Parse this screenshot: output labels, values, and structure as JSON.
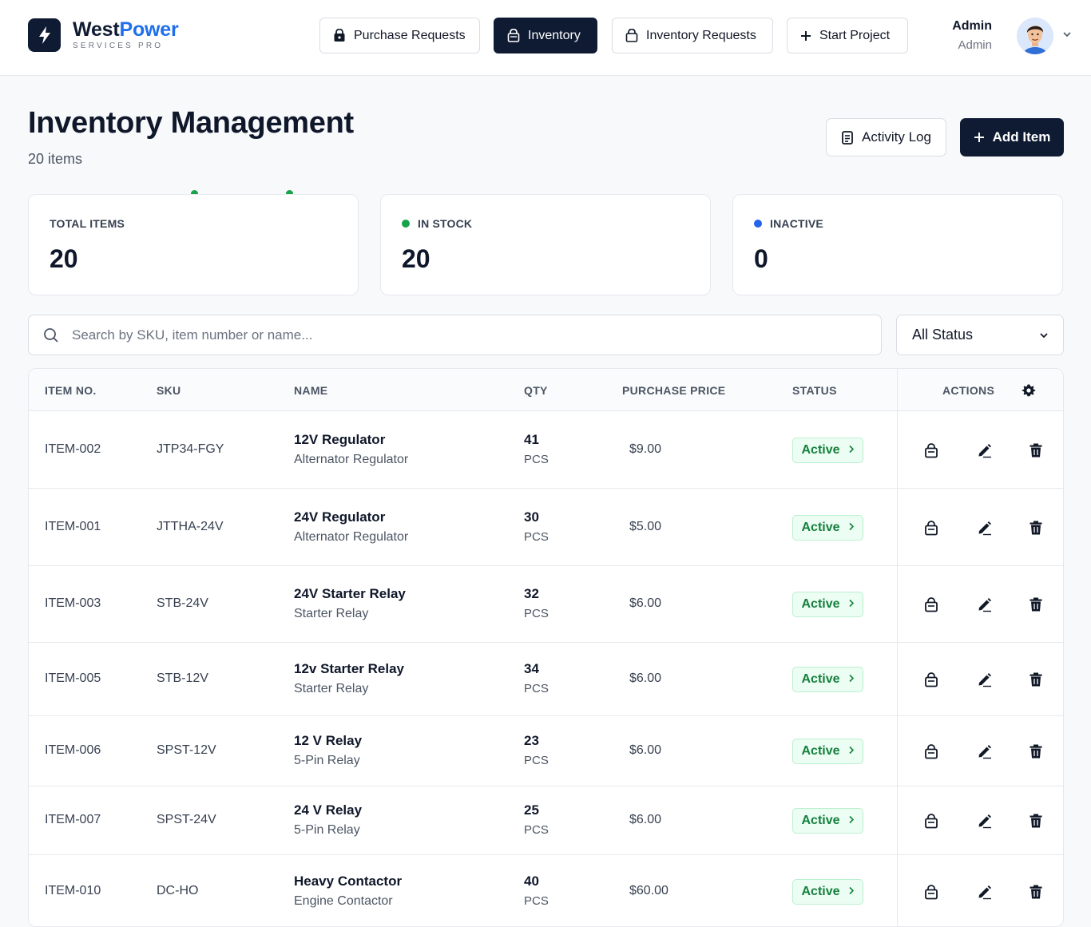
{
  "brand": {
    "name_part1": "West",
    "name_part2": "Power",
    "tagline": "SERVICES PRO"
  },
  "nav": [
    {
      "label": "Purchase Requests",
      "icon": "bag-icon"
    },
    {
      "label": "Inventory",
      "icon": "bag-icon",
      "active": true
    },
    {
      "label": "Inventory Requests",
      "icon": "bag-icon"
    },
    {
      "label": "Start Project",
      "icon": "plus-icon"
    }
  ],
  "user": {
    "name": "Admin",
    "role": "Admin"
  },
  "page": {
    "title": "Inventory Management",
    "subtitle": "20 items"
  },
  "actions": {
    "activity_log": "Activity Log",
    "add_item": "Add Item"
  },
  "stats": [
    {
      "label": "TOTAL ITEMS",
      "value": "20",
      "dot_color": ""
    },
    {
      "label": "IN STOCK",
      "value": "20",
      "dot_color": "#16a34a"
    },
    {
      "label": "INACTIVE",
      "value": "0",
      "dot_color": "#2563eb"
    }
  ],
  "search": {
    "placeholder": "Search by SKU, item number or name...",
    "value": ""
  },
  "status_filter": {
    "selected": "All Status"
  },
  "table": {
    "columns": [
      "ITEM NO.",
      "SKU",
      "NAME",
      "QTY",
      "PURCHASE PRICE",
      "STATUS",
      "ACTIONS"
    ],
    "rows": [
      {
        "item_no": "ITEM-002",
        "sku": "JTP34-FGY",
        "name": "12V Regulator",
        "desc": "Alternator Regulator",
        "qty": "41",
        "unit": "PCS",
        "price": "$9.00",
        "status": "Active"
      },
      {
        "item_no": "ITEM-001",
        "sku": "JTTHA-24V",
        "name": "24V Regulator",
        "desc": "Alternator Regulator",
        "qty": "30",
        "unit": "PCS",
        "price": "$5.00",
        "status": "Active"
      },
      {
        "item_no": "ITEM-003",
        "sku": "STB-24V",
        "name": "24V Starter Relay",
        "desc": "Starter Relay",
        "qty": "32",
        "unit": "PCS",
        "price": "$6.00",
        "status": "Active"
      },
      {
        "item_no": "ITEM-005",
        "sku": "STB-12V",
        "name": "12v Starter Relay",
        "desc": "Starter Relay",
        "qty": "34",
        "unit": "PCS",
        "price": "$6.00",
        "status": "Active"
      },
      {
        "item_no": "ITEM-006",
        "sku": "SPST-12V",
        "name": "12 V Relay",
        "desc": "5-Pin Relay",
        "qty": "23",
        "unit": "PCS",
        "price": "$6.00",
        "status": "Active"
      },
      {
        "item_no": "ITEM-007",
        "sku": "SPST-24V",
        "name": "24 V Relay",
        "desc": "5-Pin Relay",
        "qty": "25",
        "unit": "PCS",
        "price": "$6.00",
        "status": "Active"
      },
      {
        "item_no": "ITEM-010",
        "sku": "DC-HO",
        "name": "Heavy Contactor",
        "desc": "Engine Contactor",
        "qty": "40",
        "unit": "PCS",
        "price": "$60.00",
        "status": "Active"
      }
    ]
  },
  "colors": {
    "primary": "#0f1b33",
    "brand_blue": "#1f6feb",
    "success": "#15803d",
    "success_bg": "#ecfdf3"
  }
}
